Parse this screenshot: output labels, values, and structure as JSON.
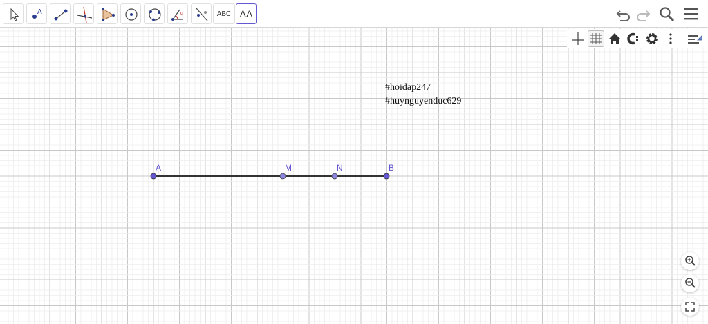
{
  "toolbar": {
    "tools": [
      {
        "name": "move-tool",
        "icon": "arrow-pointer-icon"
      },
      {
        "name": "point-tool",
        "icon": "point-a-icon"
      },
      {
        "name": "segment-tool",
        "icon": "segment-icon"
      },
      {
        "name": "perpendicular-line-tool",
        "icon": "perpendicular-icon"
      },
      {
        "name": "polygon-tool",
        "icon": "triangle-icon"
      },
      {
        "name": "circle-center-tool",
        "icon": "circle-center-icon"
      },
      {
        "name": "circle-three-points-tool",
        "icon": "circle-three-points-icon"
      },
      {
        "name": "angle-tool",
        "icon": "angle-icon"
      },
      {
        "name": "reflect-tool",
        "icon": "reflect-line-icon"
      },
      {
        "name": "text-tool",
        "label": "ABC"
      },
      {
        "name": "style-text-tool",
        "label": "AA"
      }
    ]
  },
  "graphics": {
    "text_lines": [
      "#hoidap247",
      "#huynguyenduc629"
    ],
    "points": [
      {
        "label": "A"
      },
      {
        "label": "M"
      },
      {
        "label": "N"
      },
      {
        "label": "B"
      }
    ],
    "point_color": "#6557d2",
    "segment_color": "#333333",
    "grid_major_color": "#c8c8c8",
    "grid_minor_color": "#ececec"
  }
}
